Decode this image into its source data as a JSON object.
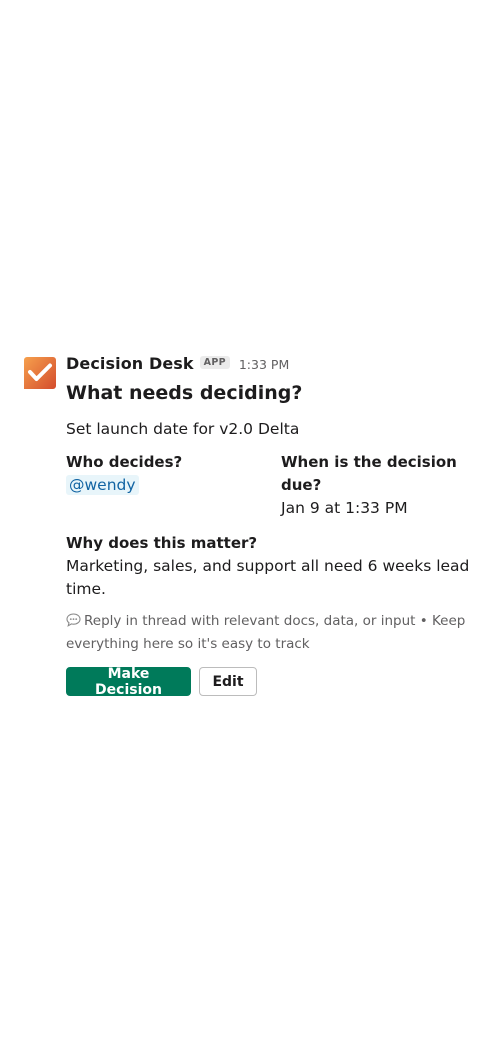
{
  "message": {
    "app_name": "Decision Desk",
    "app_badge": "APP",
    "timestamp": "1:33 PM",
    "icon": "decision-desk-check-icon",
    "question_heading": "What needs deciding?",
    "question_answer": "Set launch date for v2.0 Delta",
    "who_label": "Who decides?",
    "who_value": "@wendy",
    "when_label": "When is the decision due?",
    "when_value": "Jan 9 at 1:33 PM",
    "why_label": "Why does this matter?",
    "why_value": "Marketing, sales, and support all need 6 weeks lead time.",
    "context_icon": "speech-bubble-icon",
    "context_text": "Reply in thread with relevant docs, data, or input • Keep everything here so it's easy to track",
    "primary_button": "Make Decision",
    "secondary_button": "Edit"
  },
  "colors": {
    "primary_button": "#007a5a",
    "mention_text": "#1264a3",
    "mention_bg": "#e8f5fa",
    "app_icon_gradient_start": "#f6a04d",
    "app_icon_gradient_end": "#d2482b"
  }
}
